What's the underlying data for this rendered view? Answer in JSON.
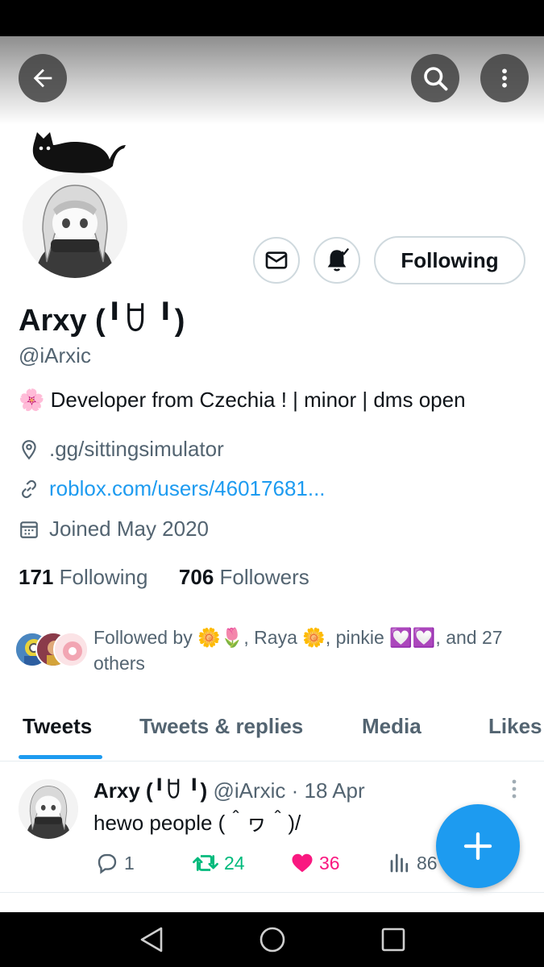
{
  "profile": {
    "name": "Arxy (╹ꇴ ╹)",
    "handle": "@iArxic",
    "bio": "🌸 Developer from Czechia !  | minor | dms open",
    "location": ".gg/sittingsimulator",
    "website": "roblox.com/users/46017681...",
    "joined": "Joined May 2020",
    "following_count": "171",
    "following_label": "Following",
    "followers_count": "706",
    "followers_label": "Followers",
    "followed_by": "Followed by 🌼🌷, Raya 🌼, pinkie 💟💟, and 27 others",
    "follow_button": "Following"
  },
  "tabs": [
    "Tweets",
    "Tweets & replies",
    "Media",
    "Likes"
  ],
  "tweet": {
    "name": "Arxy (╹ꇴ ╹)",
    "handle_date": "@iArxic · 18 Apr",
    "text": "hewo people (＾ヮ＾)/",
    "replies": "1",
    "retweets": "24",
    "likes": "36",
    "views": "86"
  },
  "colors": {
    "accent": "#1d9bf0",
    "retweet": "#00ba7c",
    "like": "#f91880",
    "muted": "#536471"
  },
  "icons": [
    "back-arrow-icon",
    "search-icon",
    "more-vertical-icon",
    "mail-icon",
    "bell-icon",
    "location-icon",
    "link-icon",
    "calendar-icon",
    "reply-icon",
    "retweet-icon",
    "heart-icon",
    "views-icon",
    "plus-icon"
  ]
}
